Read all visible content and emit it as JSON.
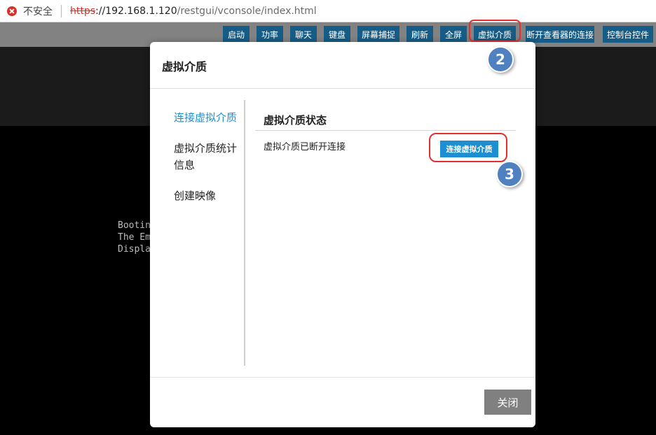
{
  "browser": {
    "security_label": "不安全",
    "url_scheme": "https",
    "url_host": "://192.168.1.120",
    "url_path": "/restgui/vconsole/index.html"
  },
  "toolbar": {
    "buttons": [
      "启动",
      "功率",
      "聊天",
      "键盘",
      "屏幕捕捉",
      "刷新",
      "全屏",
      "虚拟介质",
      "断开查看器的连接",
      "控制台控件"
    ]
  },
  "console": {
    "lines": [
      "Booting",
      "The Em",
      "Displa"
    ]
  },
  "modal": {
    "title": "虚拟介质",
    "nav": [
      "连接虚拟介质",
      "虚拟介质统计信息",
      "创建映像"
    ],
    "section_title": "虚拟介质状态",
    "status_text": "虚拟介质已断开连接",
    "connect_button": "连接虚拟介质",
    "close_button": "关闭"
  },
  "annotations": {
    "step_2": "2",
    "step_3": "3"
  }
}
